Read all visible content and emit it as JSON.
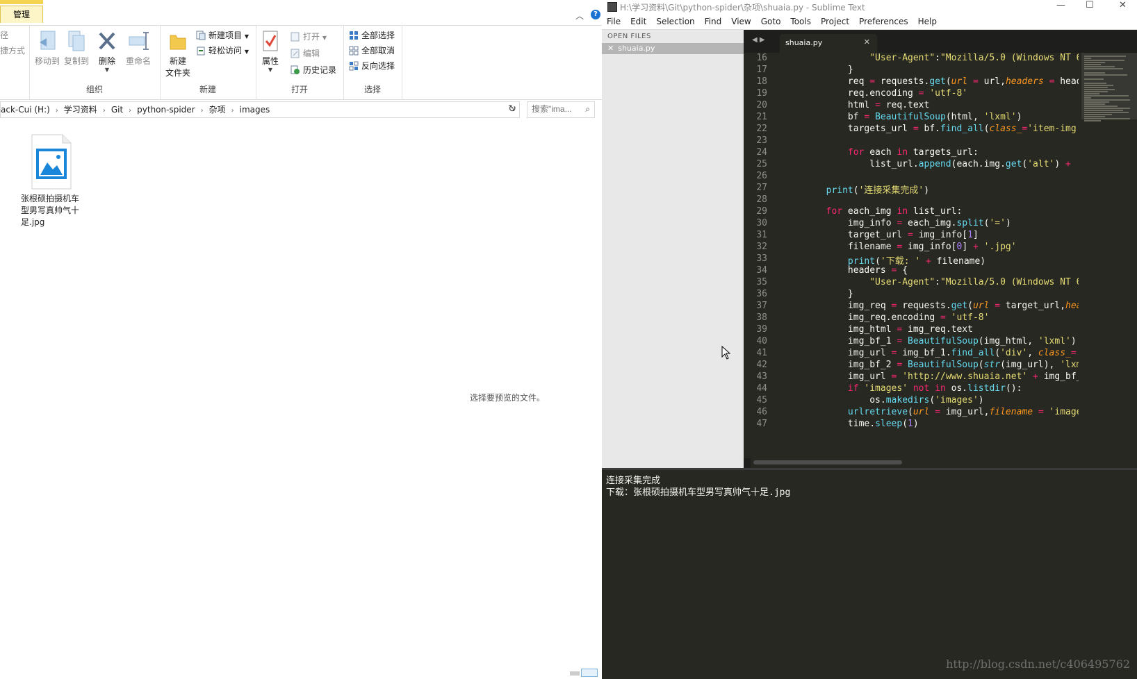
{
  "explorer": {
    "ribbon_tab": "管理",
    "ribbon": {
      "path_fragment": "径",
      "shortcut_fragment": "捷方式",
      "organize": {
        "label": "组织",
        "move_to": "移动到",
        "copy_to": "复制到",
        "delete": "删除",
        "rename": "重命名"
      },
      "new": {
        "label": "新建",
        "new_folder_line1": "新建",
        "new_folder_line2": "文件夹",
        "new_item": "新建项目",
        "easy_access": "轻松访问"
      },
      "open": {
        "label": "打开",
        "properties": "属性",
        "open": "打开",
        "edit": "编辑",
        "history": "历史记录"
      },
      "select": {
        "label": "选择",
        "select_all": "全部选择",
        "select_none": "全部取消",
        "invert": "反向选择"
      }
    },
    "breadcrumb": [
      "ack-Cui (H:)",
      "学习资料",
      "Git",
      "python-spider",
      "杂项",
      "images"
    ],
    "search_placeholder": "搜索\"ima...",
    "file": {
      "name": "张根硕拍摄机车型男写真帅气十足.jpg"
    },
    "preview_message": "选择要预览的文件。"
  },
  "sublime": {
    "title": "H:\\学习资料\\Git\\python-spider\\杂项\\shuaia.py - Sublime Text",
    "menu": [
      "File",
      "Edit",
      "Selection",
      "Find",
      "View",
      "Goto",
      "Tools",
      "Project",
      "Preferences",
      "Help"
    ],
    "sidebar_header": "OPEN FILES",
    "sidebar_file": "shuaia.py",
    "tab_label": "shuaia.py",
    "line_numbers": [
      "16",
      "17",
      "18",
      "19",
      "20",
      "21",
      "22",
      "23",
      "24",
      "25",
      "26",
      "27",
      "28",
      "29",
      "30",
      "31",
      "32",
      "33",
      "34",
      "35",
      "36",
      "37",
      "38",
      "39",
      "40",
      "41",
      "42",
      "43",
      "44",
      "45",
      "46",
      "47"
    ],
    "console": [
      "连接采集完成",
      "下载：张根硕拍摄机车型男写真帅气十足.jpg"
    ],
    "watermark": "http://blog.csdn.net/c406495762"
  },
  "colors": {
    "editor_bg": "#272822",
    "keyword": "#f92672",
    "function": "#66d9ef",
    "string": "#e6db74",
    "number": "#ae81ff",
    "param": "#fd971f"
  }
}
